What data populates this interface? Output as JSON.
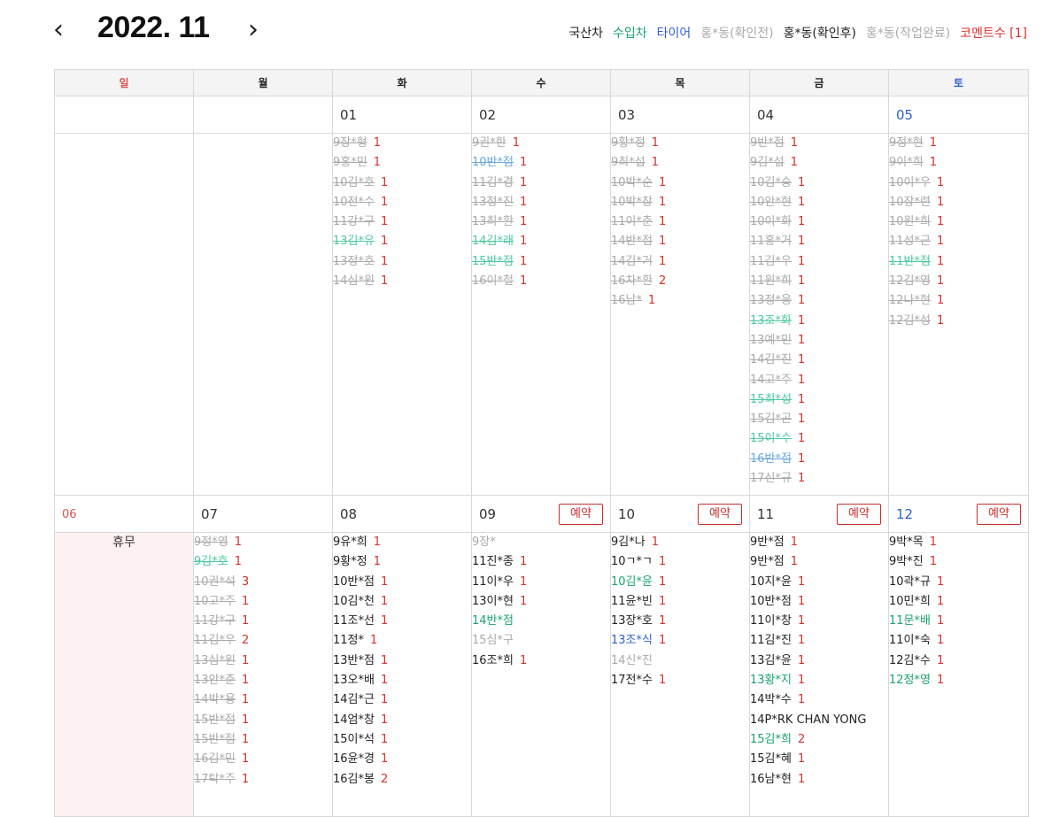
{
  "header": {
    "prev_icon": "‹",
    "next_icon": "›",
    "month_title": "2022. 11"
  },
  "legend": [
    {
      "label": "국산차",
      "color": "#222222"
    },
    {
      "label": "수입차",
      "color": "#1aa36b"
    },
    {
      "label": "타이어",
      "color": "#2f5fd0"
    },
    {
      "label": "홍*동(확인전)",
      "color": "#aaaaaa"
    },
    {
      "label": "홍*동(확인후)",
      "color": "#222222"
    },
    {
      "label": "홍*동(작업완료)",
      "color": "#aaaaaa"
    },
    {
      "label": "코멘트수 [1]",
      "color": "#d9302c"
    }
  ],
  "weekdays": [
    "일",
    "월",
    "화",
    "수",
    "목",
    "금",
    "토"
  ],
  "reserve_label": "예약",
  "holiday_label": "휴무",
  "weeks": [
    {
      "days": [
        {
          "date": "",
          "entries": []
        },
        {
          "date": "",
          "entries": []
        },
        {
          "date": "01",
          "entries": [
            {
              "t": "9장*형",
              "c": "1",
              "k": "done"
            },
            {
              "t": "9홍*민",
              "c": "1",
              "k": "done"
            },
            {
              "t": "10김*호",
              "c": "1",
              "k": "done"
            },
            {
              "t": "10전*수",
              "c": "1",
              "k": "done"
            },
            {
              "t": "11강*구",
              "c": "1",
              "k": "done"
            },
            {
              "t": "13김*유",
              "c": "1",
              "k": "done-g"
            },
            {
              "t": "13정*호",
              "c": "1",
              "k": "done"
            },
            {
              "t": "14심*원",
              "c": "1",
              "k": "done"
            }
          ]
        },
        {
          "date": "02",
          "entries": [
            {
              "t": "9권*한",
              "c": "1",
              "k": "done"
            },
            {
              "t": "10반*점",
              "c": "1",
              "k": "done-b"
            },
            {
              "t": "11김*경",
              "c": "1",
              "k": "done"
            },
            {
              "t": "13정*진",
              "c": "1",
              "k": "done"
            },
            {
              "t": "13최*환",
              "c": "1",
              "k": "done"
            },
            {
              "t": "14김*래",
              "c": "1",
              "k": "done-g"
            },
            {
              "t": "15반*점",
              "c": "1",
              "k": "done-g"
            },
            {
              "t": "16이*철",
              "c": "1",
              "k": "done"
            }
          ]
        },
        {
          "date": "03",
          "entries": [
            {
              "t": "9황*정",
              "c": "1",
              "k": "done"
            },
            {
              "t": "9최*섭",
              "c": "1",
              "k": "done"
            },
            {
              "t": "10박*순",
              "c": "1",
              "k": "done"
            },
            {
              "t": "10박*창",
              "c": "1",
              "k": "done"
            },
            {
              "t": "11이*춘",
              "c": "1",
              "k": "done"
            },
            {
              "t": "14반*점",
              "c": "1",
              "k": "done"
            },
            {
              "t": "14김*거",
              "c": "1",
              "k": "done"
            },
            {
              "t": "16차*환",
              "c": "2",
              "k": "done"
            },
            {
              "t": "16남*",
              "c": "1",
              "k": "done"
            }
          ]
        },
        {
          "date": "04",
          "entries": [
            {
              "t": "9반*점",
              "c": "1",
              "k": "done"
            },
            {
              "t": "9김*섭",
              "c": "1",
              "k": "done"
            },
            {
              "t": "10김*승",
              "c": "1",
              "k": "done"
            },
            {
              "t": "10안*현",
              "c": "1",
              "k": "done"
            },
            {
              "t": "10이*화",
              "c": "1",
              "k": "done"
            },
            {
              "t": "11홍*거",
              "c": "1",
              "k": "done"
            },
            {
              "t": "11김*우",
              "c": "1",
              "k": "done"
            },
            {
              "t": "11원*희",
              "c": "1",
              "k": "done"
            },
            {
              "t": "13정*웅",
              "c": "1",
              "k": "done"
            },
            {
              "t": "13조*화",
              "c": "1",
              "k": "done-g"
            },
            {
              "t": "13예*민",
              "c": "1",
              "k": "done"
            },
            {
              "t": "14김*진",
              "c": "1",
              "k": "done"
            },
            {
              "t": "14고*주",
              "c": "1",
              "k": "done"
            },
            {
              "t": "15최*성",
              "c": "1",
              "k": "done-g"
            },
            {
              "t": "15김*곤",
              "c": "1",
              "k": "done"
            },
            {
              "t": "15이*수",
              "c": "1",
              "k": "done-g"
            },
            {
              "t": "16반*점",
              "c": "1",
              "k": "done-b"
            },
            {
              "t": "17신*규",
              "c": "1",
              "k": "done"
            }
          ]
        },
        {
          "date": "05",
          "entries": [
            {
              "t": "9정*현",
              "c": "1",
              "k": "done"
            },
            {
              "t": "9이*희",
              "c": "1",
              "k": "done"
            },
            {
              "t": "10이*우",
              "c": "1",
              "k": "done"
            },
            {
              "t": "10장*련",
              "c": "1",
              "k": "done"
            },
            {
              "t": "10원*희",
              "c": "1",
              "k": "done"
            },
            {
              "t": "11성*근",
              "c": "1",
              "k": "done"
            },
            {
              "t": "11반*점",
              "c": "1",
              "k": "done-g"
            },
            {
              "t": "12김*영",
              "c": "1",
              "k": "done"
            },
            {
              "t": "12나*현",
              "c": "1",
              "k": "done"
            },
            {
              "t": "12김*성",
              "c": "1",
              "k": "done"
            }
          ]
        }
      ]
    },
    {
      "days": [
        {
          "date": "06",
          "holiday": true,
          "entries": []
        },
        {
          "date": "07",
          "entries": [
            {
              "t": "9정*영",
              "c": "1",
              "k": "done"
            },
            {
              "t": "9김*호",
              "c": "1",
              "k": "done-g"
            },
            {
              "t": "10권*석",
              "c": "3",
              "k": "done"
            },
            {
              "t": "10고*주",
              "c": "1",
              "k": "done"
            },
            {
              "t": "11강*구",
              "c": "1",
              "k": "done"
            },
            {
              "t": "11김*우",
              "c": "2",
              "k": "done"
            },
            {
              "t": "13심*원",
              "c": "1",
              "k": "done"
            },
            {
              "t": "13안*춘",
              "c": "1",
              "k": "done"
            },
            {
              "t": "14박*용",
              "c": "1",
              "k": "done"
            },
            {
              "t": "15반*점",
              "c": "1",
              "k": "done"
            },
            {
              "t": "15반*점",
              "c": "1",
              "k": "done"
            },
            {
              "t": "16김*민",
              "c": "1",
              "k": "done"
            },
            {
              "t": "17탁*주",
              "c": "1",
              "k": "done"
            }
          ]
        },
        {
          "date": "08",
          "entries": [
            {
              "t": "9유*희",
              "c": "1",
              "k": "active"
            },
            {
              "t": "9황*정",
              "c": "1",
              "k": "active"
            },
            {
              "t": "10반*점",
              "c": "1",
              "k": "active"
            },
            {
              "t": "10김*천",
              "c": "1",
              "k": "active"
            },
            {
              "t": "11조*선",
              "c": "1",
              "k": "active"
            },
            {
              "t": "11정*",
              "c": "1",
              "k": "active"
            },
            {
              "t": "13반*점",
              "c": "1",
              "k": "active"
            },
            {
              "t": "13오*배",
              "c": "1",
              "k": "active"
            },
            {
              "t": "14김*근",
              "c": "1",
              "k": "active"
            },
            {
              "t": "14엄*창",
              "c": "1",
              "k": "active"
            },
            {
              "t": "15이*석",
              "c": "1",
              "k": "active"
            },
            {
              "t": "16윤*경",
              "c": "1",
              "k": "active"
            },
            {
              "t": "16김*봉",
              "c": "2",
              "k": "active"
            }
          ]
        },
        {
          "date": "09",
          "reserve": true,
          "entries": [
            {
              "t": "9장*",
              "c": "",
              "k": "pending"
            },
            {
              "t": "11진*종",
              "c": "1",
              "k": "active"
            },
            {
              "t": "11이*우",
              "c": "1",
              "k": "active"
            },
            {
              "t": "13이*현",
              "c": "1",
              "k": "active"
            },
            {
              "t": "14반*점",
              "c": "",
              "k": "green"
            },
            {
              "t": "15심*구",
              "c": "",
              "k": "pending"
            },
            {
              "t": "16조*희",
              "c": "1",
              "k": "active"
            }
          ]
        },
        {
          "date": "10",
          "reserve": true,
          "entries": [
            {
              "t": "9김*나",
              "c": "1",
              "k": "active"
            },
            {
              "t": "10ㄱ*ㄱ",
              "c": "1",
              "k": "active"
            },
            {
              "t": "10김*윤",
              "c": "1",
              "k": "green"
            },
            {
              "t": "11윤*빈",
              "c": "1",
              "k": "active"
            },
            {
              "t": "13장*호",
              "c": "1",
              "k": "active"
            },
            {
              "t": "13조*식",
              "c": "1",
              "k": "blue"
            },
            {
              "t": "14신*진",
              "c": "",
              "k": "pending"
            },
            {
              "t": "17전*수",
              "c": "1",
              "k": "active"
            }
          ]
        },
        {
          "date": "11",
          "reserve": true,
          "entries": [
            {
              "t": "9반*점",
              "c": "1",
              "k": "active"
            },
            {
              "t": "9반*점",
              "c": "1",
              "k": "active"
            },
            {
              "t": "10지*윤",
              "c": "1",
              "k": "active"
            },
            {
              "t": "10반*점",
              "c": "1",
              "k": "active"
            },
            {
              "t": "11이*창",
              "c": "1",
              "k": "active"
            },
            {
              "t": "11김*진",
              "c": "1",
              "k": "active"
            },
            {
              "t": "13김*윤",
              "c": "1",
              "k": "active"
            },
            {
              "t": "13황*지",
              "c": "1",
              "k": "green"
            },
            {
              "t": "14박*수",
              "c": "1",
              "k": "active"
            },
            {
              "t": "14P*RK CHAN YONG",
              "c": "",
              "k": "active"
            },
            {
              "t": "15김*희",
              "c": "2",
              "k": "green"
            },
            {
              "t": "15김*혜",
              "c": "1",
              "k": "active"
            },
            {
              "t": "16남*현",
              "c": "1",
              "k": "active"
            }
          ]
        },
        {
          "date": "12",
          "reserve": true,
          "entries": [
            {
              "t": "9박*목",
              "c": "1",
              "k": "active"
            },
            {
              "t": "9박*진",
              "c": "1",
              "k": "active"
            },
            {
              "t": "10곽*규",
              "c": "1",
              "k": "active"
            },
            {
              "t": "10민*희",
              "c": "1",
              "k": "active"
            },
            {
              "t": "11문*배",
              "c": "1",
              "k": "green"
            },
            {
              "t": "11이*숙",
              "c": "1",
              "k": "active"
            },
            {
              "t": "12김*수",
              "c": "1",
              "k": "active"
            },
            {
              "t": "12정*영",
              "c": "1",
              "k": "green"
            }
          ]
        }
      ]
    }
  ]
}
